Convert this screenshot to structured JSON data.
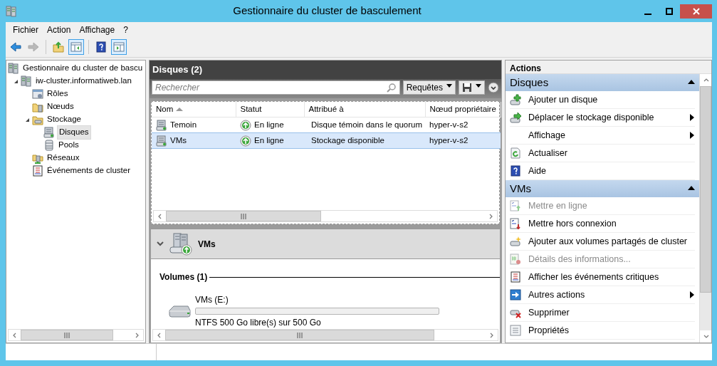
{
  "window": {
    "title": "Gestionnaire du cluster de basculement"
  },
  "menu": [
    "Fichier",
    "Action",
    "Affichage",
    "?"
  ],
  "toolbar": [
    {
      "disabled": false,
      "pressed": false
    },
    {
      "disabled": true,
      "pressed": false
    },
    {
      "disabled": false,
      "pressed": false
    },
    {
      "disabled": false,
      "pressed": true
    },
    {
      "disabled": false,
      "pressed": false
    },
    {
      "disabled": false,
      "pressed": true
    }
  ],
  "tree": [
    {
      "label": "Gestionnaire du cluster de bascu",
      "selected": false,
      "children": [
        {
          "label": "iw-cluster.informatiweb.lan",
          "selected": false,
          "expanded": true,
          "children": [
            {
              "label": "Rôles",
              "selected": false
            },
            {
              "label": "Nœuds",
              "selected": false
            },
            {
              "label": "Stockage",
              "selected": false,
              "expanded": true,
              "children": [
                {
                  "label": "Disques",
                  "selected": true
                },
                {
                  "label": "Pools",
                  "selected": false
                }
              ]
            },
            {
              "label": "Réseaux",
              "selected": false
            },
            {
              "label": "Événements de cluster",
              "selected": false
            }
          ]
        }
      ]
    }
  ],
  "center": {
    "title": "Disques (2)",
    "search": {
      "placeholder": "Rechercher"
    },
    "queries_button": "Requêtes",
    "columns": [
      {
        "label": "Nom",
        "sorted": true
      },
      {
        "label": "Statut",
        "sorted": false
      },
      {
        "label": "Attribué à",
        "sorted": false
      },
      {
        "label": "Nœud propriétaire",
        "sorted": false
      }
    ],
    "rows": [
      {
        "cells": [
          "Temoin",
          "En ligne",
          "Disque témoin dans le quorum",
          "hyper-v-s2"
        ],
        "selected": false
      },
      {
        "cells": [
          "VMs",
          "En ligne",
          "Stockage disponible",
          "hyper-v-s2"
        ],
        "selected": true
      }
    ],
    "details": {
      "title": "VMs",
      "section": "Volumes (1)",
      "volumes": [
        {
          "name": "VMs (E:)",
          "level": 0,
          "info": "NTFS 500 Go libre(s) sur 500 Go"
        }
      ]
    }
  },
  "actions": {
    "title": "Actions",
    "groups": [
      {
        "title": "Disques",
        "expanded": true,
        "items": [
          {
            "label": "Ajouter un disque",
            "disabled": false,
            "submenu": false
          },
          {
            "label": "Déplacer le stockage disponible",
            "disabled": false,
            "submenu": true
          },
          {
            "label": "Affichage",
            "disabled": false,
            "submenu": true
          },
          {
            "label": "Actualiser",
            "disabled": false,
            "submenu": false
          },
          {
            "label": "Aide",
            "disabled": false,
            "submenu": false
          }
        ]
      },
      {
        "title": "VMs",
        "expanded": true,
        "items": [
          {
            "label": "Mettre en ligne",
            "disabled": true,
            "submenu": false
          },
          {
            "label": "Mettre hors connexion",
            "disabled": false,
            "submenu": false
          },
          {
            "label": "Ajouter aux volumes partagés de cluster",
            "disabled": false,
            "submenu": false
          },
          {
            "label": "Détails des informations...",
            "disabled": true,
            "submenu": false
          },
          {
            "label": "Afficher les événements critiques",
            "disabled": false,
            "submenu": false
          },
          {
            "label": "Autres actions",
            "disabled": false,
            "submenu": true
          },
          {
            "label": "Supprimer",
            "disabled": false,
            "submenu": false
          },
          {
            "label": "Propriétés",
            "disabled": false,
            "submenu": false
          }
        ]
      }
    ]
  }
}
